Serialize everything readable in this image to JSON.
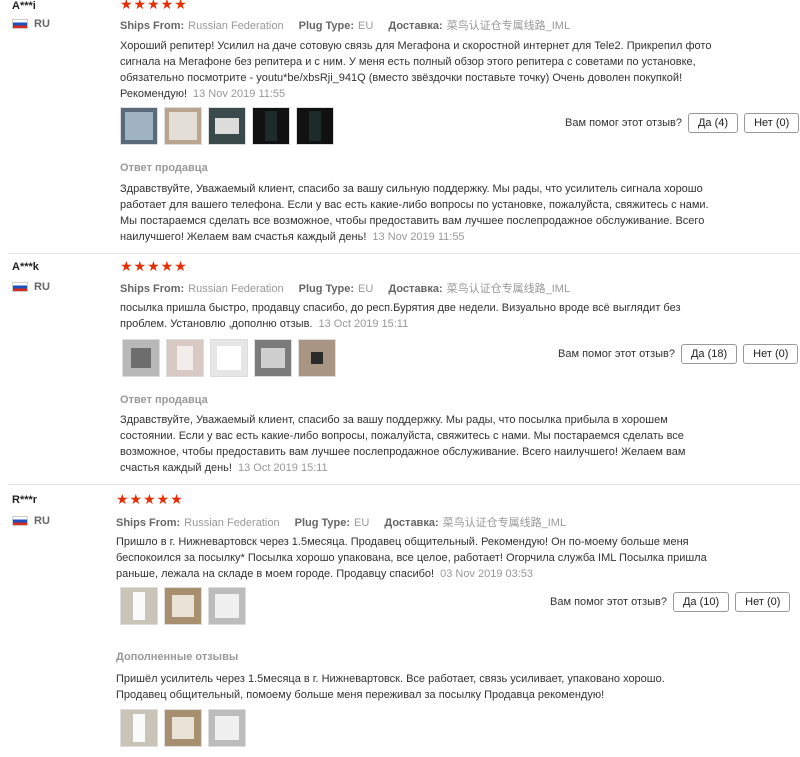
{
  "reviews": [
    {
      "user": "A***i",
      "country": "RU",
      "stars": "★★★★★",
      "ships_from_label": "Ships From:",
      "ships_from": "Russian Federation",
      "plug_label": "Plug Type:",
      "plug": "EU",
      "delivery_label": "Доставка:",
      "delivery": "菜鸟认证仓专属线路_IML",
      "text": "Хороший репитер! Усилил на даче сотовую связь для Мегафона и скоростной интернет для Tele2. Прикрепил фото сигнала на Мегафоне без репитера и с ним. У меня есть полный обзор этого репитера с советами по установке, обязательно посмотрите - youtu*be/xbsRji_941Q (вместо звёздочки поставьте точку) Очень доволен покупкой! Рекомендую!",
      "date": "13 Nov 2019 11:55",
      "helpful_label": "Вам помог этот отзыв?",
      "yes_label": "Да (4)",
      "no_label": "Нет (0)",
      "reply_title": "Ответ продавца",
      "reply_text": "Здравствуйте, Уважаемый клиент, спасибо за вашу сильную поддержку. Мы рады, что усилитель сигнала хорошо работает для вашего телефона. Если у вас есть какие-либо вопросы по установке, пожалуйста, свяжитесь с нами. Мы постараемся сделать все возможное, чтобы предоставить вам лучшее послепродажное обслуживание. Всего наилучшего! Желаем вам счастья каждый день!",
      "reply_date": "13 Nov 2019 11:55"
    },
    {
      "user": "A***k",
      "country": "RU",
      "stars": "★★★★★",
      "ships_from_label": "Ships From:",
      "ships_from": "Russian Federation",
      "plug_label": "Plug Type:",
      "plug": "EU",
      "delivery_label": "Доставка:",
      "delivery": "菜鸟认证仓专属线路_IML",
      "text": "посылка пришла быстро, продавцу спасибо, до респ.Бурятия две недели. Визуально вроде всё выглядит без проблем. Установлю ,дополню отзыв.",
      "date": "13 Oct 2019 15:11",
      "helpful_label": "Вам помог этот отзыв?",
      "yes_label": "Да (18)",
      "no_label": "Нет (0)",
      "reply_title": "Ответ продавца",
      "reply_text": "Здравствуйте, Уважаемый клиент, спасибо за вашу поддержку. Мы рады, что посылка прибыла в хорошем состоянии. Если у вас есть какие-либо вопросы, пожалуйста, свяжитесь с нами. Мы постараемся сделать все возможное, чтобы предоставить вам лучшее послепродажное обслуживание. Всего наилучшего! Желаем вам счастья каждый день!",
      "reply_date": "13 Oct 2019 15:11"
    },
    {
      "user": "R***r",
      "country": "RU",
      "stars": "★★★★★",
      "ships_from_label": "Ships From:",
      "ships_from": "Russian Federation",
      "plug_label": "Plug Type:",
      "plug": "EU",
      "delivery_label": "Доставка:",
      "delivery": "菜鸟认证仓专属线路_IML",
      "text": "Пришло в г. Нижневартовск через 1.5месяца. Продавец общительный. Рекомендую! Он по-моему больше меня беспокоился за посылку* Посылка хорошо упакована, все целое, работает! Огорчила служба IML Посылка пришла раньше, лежала на складе в моем городе. Продавцу спасибо!",
      "date": "03 Nov 2019 03:53",
      "helpful_label": "Вам помог этот отзыв?",
      "yes_label": "Да (10)",
      "no_label": "Нет (0)",
      "additional_title": "Дополненные отзывы",
      "additional_text": "Пришёл усилитель через 1.5месяца в г. Нижневартовск. Все работает, связь усиливает, упаковано хорошо. Продавец общительный, помоему больше меня переживал за посылку Продавца рекомендую!"
    }
  ],
  "colors": {
    "star": "#e62e04",
    "muted": "#999999",
    "text": "#333333"
  }
}
